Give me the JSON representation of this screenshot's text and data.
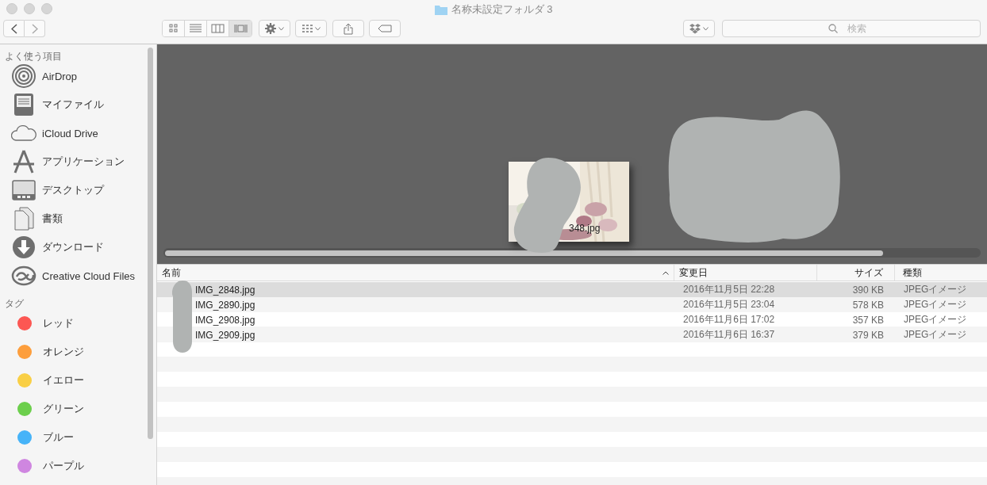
{
  "window": {
    "title": "名称未設定フォルダ 3"
  },
  "toolbar": {
    "view_modes": [
      {
        "kind": "icons",
        "selected": false
      },
      {
        "kind": "list",
        "selected": false
      },
      {
        "kind": "columns",
        "selected": false
      },
      {
        "kind": "coverflow",
        "selected": true
      }
    ]
  },
  "search": {
    "placeholder": "検索"
  },
  "sidebar": {
    "favorites_title": "よく使う項目",
    "favorites": [
      {
        "label": "AirDrop",
        "kind": "airdrop"
      },
      {
        "label": "マイファイル",
        "kind": "tray"
      },
      {
        "label": "iCloud Drive",
        "kind": "cloud"
      },
      {
        "label": "アプリケーション",
        "kind": "apps"
      },
      {
        "label": "デスクトップ",
        "kind": "desktop"
      },
      {
        "label": "書類",
        "kind": "documents"
      },
      {
        "label": "ダウンロード",
        "kind": "download"
      },
      {
        "label": "Creative Cloud Files",
        "kind": "creative"
      }
    ],
    "tags_title": "タグ",
    "tags": [
      {
        "label": "レッド",
        "color": "#fc5753"
      },
      {
        "label": "オレンジ",
        "color": "#fd9e3c"
      },
      {
        "label": "イエロー",
        "color": "#f9cf45"
      },
      {
        "label": "グリーン",
        "color": "#6ccf4c"
      },
      {
        "label": "ブルー",
        "color": "#46b3f8"
      },
      {
        "label": "パープル",
        "color": "#cf86e0"
      }
    ]
  },
  "preview": {
    "kind": "picture",
    "caption": "348.jpg"
  },
  "table": {
    "columns": [
      {
        "label": "名前"
      },
      {
        "label": "変更日"
      },
      {
        "label": "サイズ"
      },
      {
        "label": "種類"
      }
    ],
    "rows": [
      {
        "name": "IMG_2848.jpg",
        "date": "2016年11月5日 22:28",
        "size": "390 KB",
        "kind": "JPEGイメージ",
        "selected": true
      },
      {
        "name": "IMG_2890.jpg",
        "date": "2016年11月5日 23:04",
        "size": "578 KB",
        "kind": "JPEGイメージ",
        "selected": false
      },
      {
        "name": "IMG_2908.jpg",
        "date": "2016年11月6日 17:02",
        "size": "357 KB",
        "kind": "JPEGイメージ",
        "selected": false
      },
      {
        "name": "IMG_2909.jpg",
        "date": "2016年11月6日 16:37",
        "size": "379 KB",
        "kind": "JPEGイメージ",
        "selected": false
      }
    ]
  }
}
